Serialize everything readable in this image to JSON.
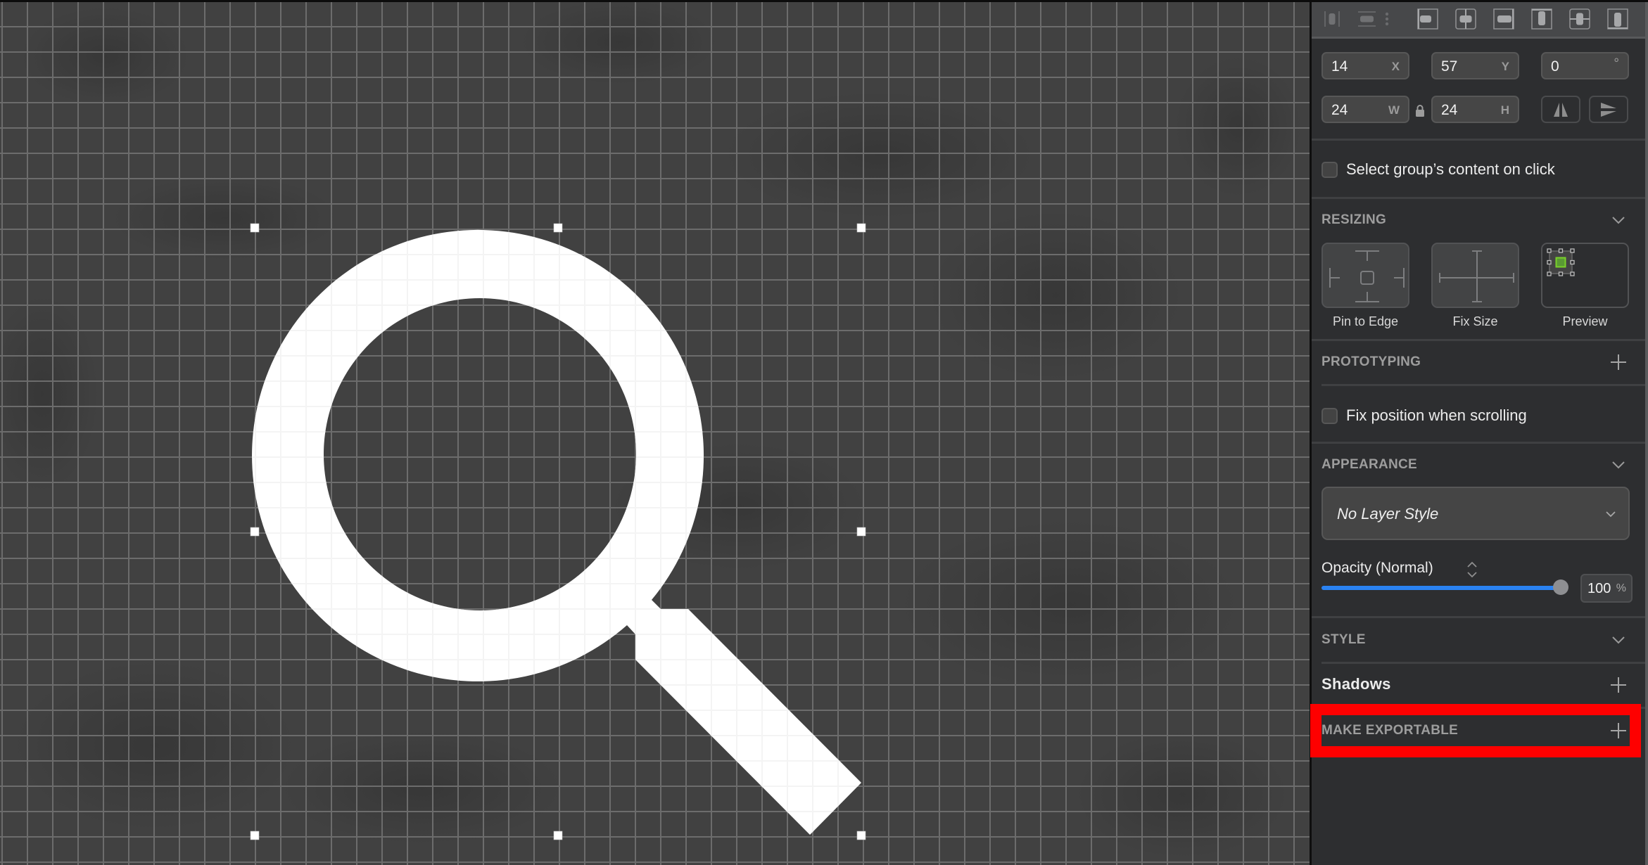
{
  "canvas": {
    "selected_shape": "search-magnifier-glyph",
    "selection_handles": [
      "top-left",
      "top-center",
      "top-right",
      "middle-left",
      "middle-right",
      "bottom-left",
      "bottom-center",
      "bottom-right"
    ],
    "colors": {
      "background": "#414141",
      "grid_line": "#6c6c6c",
      "shape_fill": "#ffffff",
      "handle_fill": "#ffffff"
    }
  },
  "inspector": {
    "align_toolbar": [
      {
        "id": "distribute-horizontal",
        "icon": "distribute-horizontal-icon",
        "enabled": false
      },
      {
        "id": "distribute-vertical",
        "icon": "distribute-vertical-icon",
        "enabled": false
      },
      {
        "id": "more",
        "icon": "more-vertical-icon",
        "enabled": false
      },
      {
        "id": "align-left",
        "icon": "align-left-icon",
        "enabled": true
      },
      {
        "id": "align-horizontal-center",
        "icon": "align-horizontal-center-icon",
        "enabled": true
      },
      {
        "id": "align-right",
        "icon": "align-right-icon",
        "enabled": true
      },
      {
        "id": "align-top",
        "icon": "align-top-icon",
        "enabled": true
      },
      {
        "id": "align-vertical-center",
        "icon": "align-vertical-center-icon",
        "enabled": true
      },
      {
        "id": "align-bottom",
        "icon": "align-bottom-icon",
        "enabled": true
      }
    ],
    "geometry": {
      "x": {
        "value": "14",
        "unit": "X"
      },
      "y": {
        "value": "57",
        "unit": "Y"
      },
      "rotation": {
        "value": "0",
        "unit": "°"
      },
      "width": {
        "value": "24",
        "unit": "W"
      },
      "height": {
        "value": "24",
        "unit": "H"
      },
      "proportions_locked": true,
      "flip_horizontal_icon": "flip-horizontal-icon",
      "flip_vertical_icon": "flip-vertical-icon"
    },
    "select_group_content": {
      "label": "Select group’s content on click",
      "checked": false
    },
    "resizing": {
      "title": "RESIZING",
      "options": [
        {
          "label": "Pin to Edge",
          "icon": "pin-to-edge-icon"
        },
        {
          "label": "Fix Size",
          "icon": "fix-size-icon"
        },
        {
          "label": "Preview",
          "icon": "resize-preview-icon"
        }
      ]
    },
    "prototyping": {
      "title": "PROTOTYPING"
    },
    "fix_position": {
      "label": "Fix position when scrolling",
      "checked": false
    },
    "appearance": {
      "title": "APPEARANCE",
      "layer_style": "No Layer Style",
      "opacity_label": "Opacity (Normal)",
      "opacity_percent": 100,
      "opacity_value": "100",
      "opacity_unit": "%",
      "accent_color": "#2a82f1"
    },
    "style": {
      "title": "STYLE"
    },
    "shadows": {
      "title": "Shadows"
    },
    "make_exportable": {
      "title": "MAKE EXPORTABLE",
      "highlight_color": "#fe0000"
    }
  }
}
